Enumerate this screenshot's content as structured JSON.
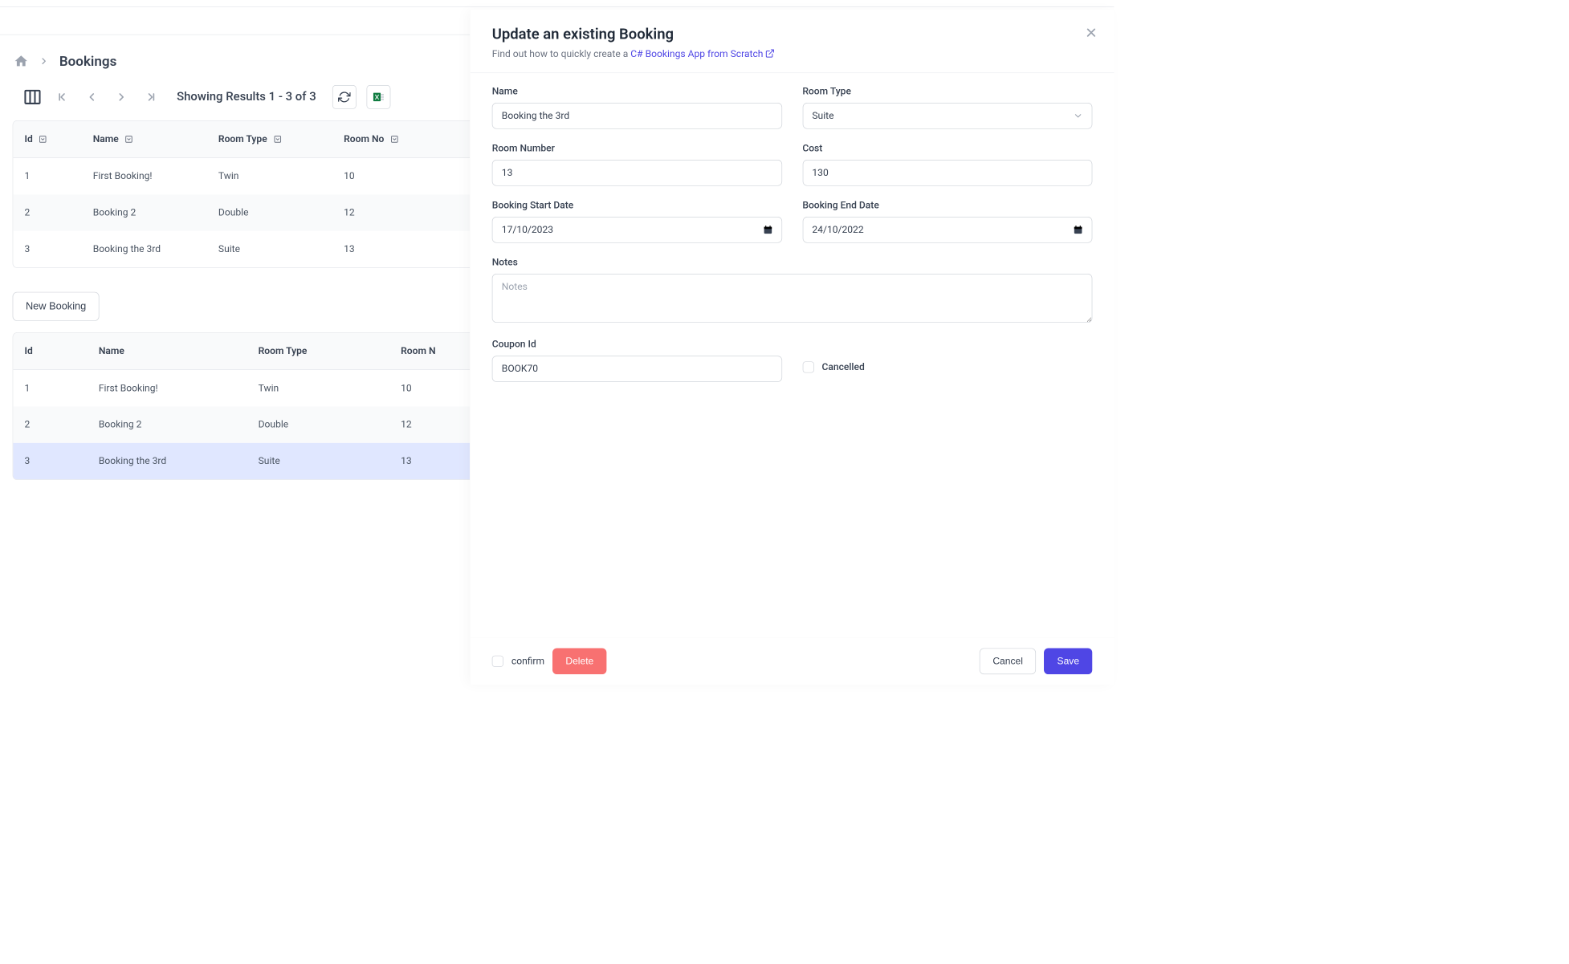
{
  "breadcrumb": {
    "title": "Bookings"
  },
  "toolbar": {
    "results": "Showing Results 1 - 3 of 3"
  },
  "table1": {
    "headers": [
      "Id",
      "Name",
      "Room Type",
      "Room No"
    ],
    "rows": [
      {
        "id": "1",
        "name": "First Booking!",
        "type": "Twin",
        "no": "10"
      },
      {
        "id": "2",
        "name": "Booking 2",
        "type": "Double",
        "no": "12"
      },
      {
        "id": "3",
        "name": "Booking the 3rd",
        "type": "Suite",
        "no": "13"
      }
    ]
  },
  "newBooking": {
    "label": "New Booking"
  },
  "table2": {
    "headers": [
      "Id",
      "Name",
      "Room Type",
      "Room N"
    ],
    "rows": [
      {
        "id": "1",
        "name": "First Booking!",
        "type": "Twin",
        "no": "10"
      },
      {
        "id": "2",
        "name": "Booking 2",
        "type": "Double",
        "no": "12"
      },
      {
        "id": "3",
        "name": "Booking the 3rd",
        "type": "Suite",
        "no": "13"
      }
    ]
  },
  "drawer": {
    "title": "Update an existing Booking",
    "subPrefix": "Find out how to quickly create a ",
    "subLink": "C# Bookings App from Scratch",
    "form": {
      "name": {
        "label": "Name",
        "value": "Booking the 3rd"
      },
      "roomType": {
        "label": "Room Type",
        "value": "Suite"
      },
      "roomNumber": {
        "label": "Room Number",
        "value": "13"
      },
      "cost": {
        "label": "Cost",
        "value": "130"
      },
      "startDate": {
        "label": "Booking Start Date",
        "value": "17/10/2023"
      },
      "endDate": {
        "label": "Booking End Date",
        "value": "24/10/2022"
      },
      "notes": {
        "label": "Notes",
        "placeholder": "Notes"
      },
      "couponId": {
        "label": "Coupon Id",
        "value": "BOOK70"
      },
      "cancelled": {
        "label": "Cancelled"
      }
    },
    "footer": {
      "confirm": "confirm",
      "delete": "Delete",
      "cancel": "Cancel",
      "save": "Save"
    }
  }
}
